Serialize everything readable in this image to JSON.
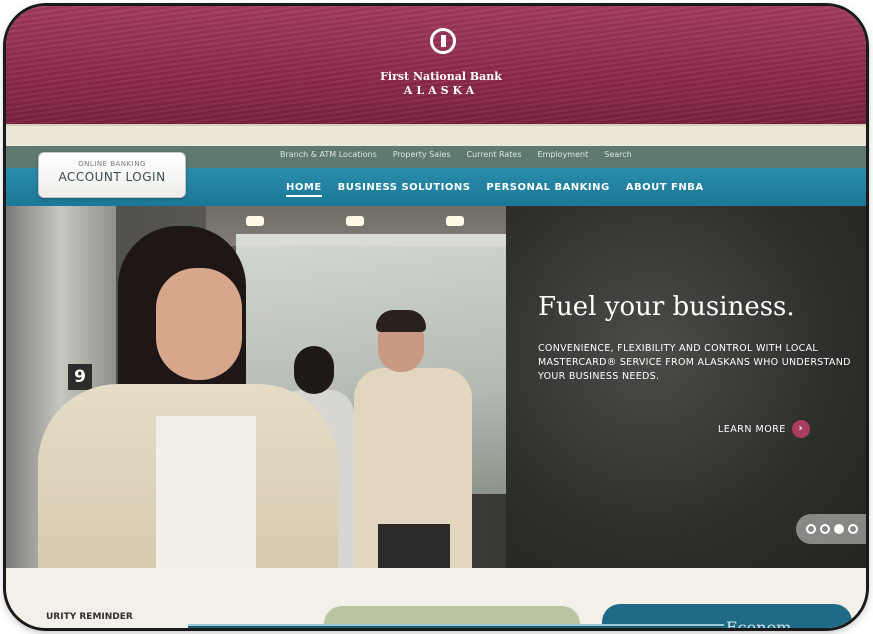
{
  "header": {
    "bank_name": "First National Bank",
    "bank_region": "ALASKA"
  },
  "utility_nav": {
    "links": [
      "Branch & ATM Locations",
      "Property Sales",
      "Current Rates",
      "Employment",
      "Search"
    ]
  },
  "main_nav": {
    "items": [
      "HOME",
      "BUSINESS SOLUTIONS",
      "PERSONAL BANKING",
      "ABOUT FNBA"
    ],
    "active": "HOME"
  },
  "login": {
    "small_label": "ONLINE BANKING",
    "big_label": "ACCOUNT LOGIN"
  },
  "hero": {
    "floor_number": "9",
    "title": "Fuel your business.",
    "body": "CONVENIENCE, FLEXIBILITY AND CONTROL WITH LOCAL MASTERCARD® SERVICE FROM ALASKANS WHO UNDERSTAND YOUR BUSINESS NEEDS.",
    "cta_label": "LEARN MORE",
    "cta_icon": "chevron-right-icon",
    "carousel_count": 4,
    "carousel_active": 3
  },
  "bottom": {
    "security_label": "URITY REMINDER",
    "blue_panel_text": "Econom"
  },
  "colors": {
    "brand_maroon": "#8e2a4d",
    "nav_teal": "#1b7896",
    "utility_green": "#5e7a70",
    "accent_pink": "#a83c63"
  }
}
